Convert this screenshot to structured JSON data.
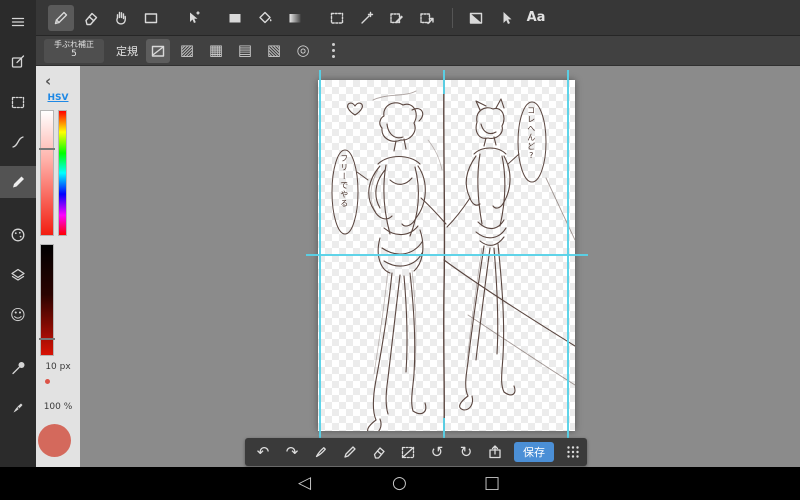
{
  "top_toolbar": {
    "tools": [
      "brush",
      "eraser",
      "hand",
      "shape",
      "transform",
      "fill-rect",
      "bucket",
      "gradient",
      "select-rect",
      "magic-wand",
      "select-pen",
      "select-move",
      "tone",
      "cursor",
      "text"
    ],
    "selected_tool": "brush",
    "text_tool_label": "Aa"
  },
  "ruler_toolbar": {
    "stabilizer_label": "手ぶれ補正",
    "stabilizer_value": "5",
    "ruler_label": "定規",
    "rulers": [
      "snap",
      "hatch",
      "grid",
      "horizontal-lines",
      "diagonal",
      "concentric"
    ],
    "selected_ruler": "snap"
  },
  "sidebar": {
    "items": [
      "menu",
      "edit-note",
      "select",
      "curve",
      "pencil",
      "palette",
      "layers",
      "face",
      "eyedropper",
      "pen"
    ],
    "selected_item": "pencil"
  },
  "color_panel": {
    "collapse_icon": "‹",
    "mode_label": "HSV",
    "brush_size": "10 px",
    "opacity": "100 %",
    "brush_color": "#d4695c"
  },
  "canvas": {
    "guide_color": "#57d2e8",
    "sketch_color": "#4a342d",
    "bubble_text_left": "フリーでやる",
    "bubble_text_right": "コレへんど?"
  },
  "bottom_toolbar": {
    "buttons": [
      "undo",
      "redo",
      "pen",
      "pencil",
      "eraser",
      "deselect",
      "rotate-ccw",
      "rotate-cw",
      "export",
      "save",
      "grid"
    ],
    "save_label": "保存"
  },
  "nav_bar": {
    "back": "◁",
    "home": "○",
    "recent": "□"
  },
  "icons": {
    "undo": "↶",
    "redo": "↷",
    "rotate_ccw": "↺",
    "rotate_cw": "↻",
    "smiley": "☺",
    "hatch": "▨",
    "grid": "▦",
    "hlines": "▤",
    "diag": "▧",
    "concentric": "◎"
  }
}
